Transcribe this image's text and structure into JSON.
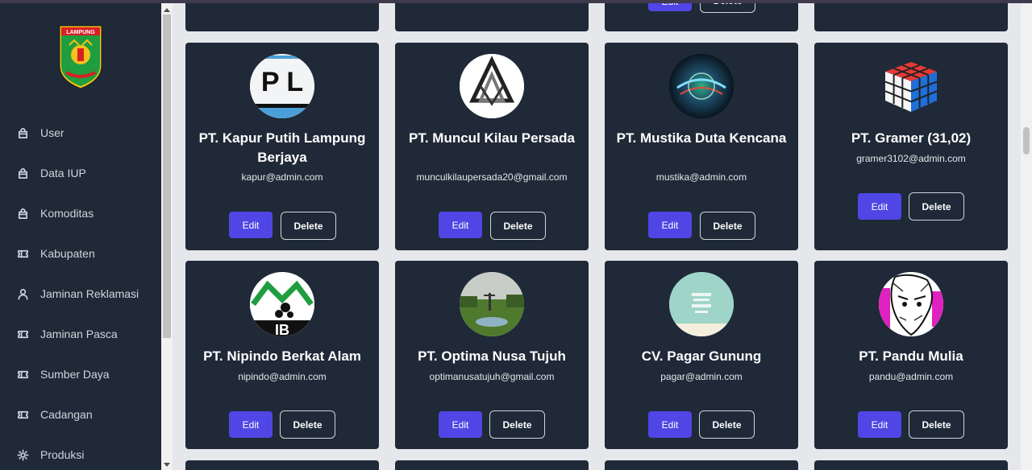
{
  "sidebar": {
    "logo_text": "LAMPUNG",
    "items": [
      {
        "label": "User",
        "icon": "bag-icon"
      },
      {
        "label": "Data IUP",
        "icon": "bag-icon"
      },
      {
        "label": "Komoditas",
        "icon": "bag-icon"
      },
      {
        "label": "Kabupaten",
        "icon": "ticket-icon"
      },
      {
        "label": "Jaminan Reklamasi",
        "icon": "user-icon"
      },
      {
        "label": "Jaminan Pasca",
        "icon": "ticket-icon"
      },
      {
        "label": "Sumber Daya",
        "icon": "ticket-icon"
      },
      {
        "label": "Cadangan",
        "icon": "ticket-icon"
      },
      {
        "label": "Produksi",
        "icon": "gear-icon"
      }
    ]
  },
  "actions": {
    "edit_label": "Edit",
    "delete_label": "Delete"
  },
  "companies": [
    {
      "name": "PT. Kapur Putih Lampung Berjaya",
      "email": "kapur@admin.com",
      "avatar_text": "P L"
    },
    {
      "name": "PT. Muncul Kilau Persada",
      "email": "munculkilaupersada20@gmail.com"
    },
    {
      "name": "PT. Mustika Duta Kencana",
      "email": "mustika@admin.com"
    },
    {
      "name": "PT. Gramer (31,02)",
      "email": "gramer3102@admin.com"
    },
    {
      "name": "PT. Nipindo Berkat Alam",
      "email": "nipindo@admin.com",
      "avatar_text": "IB"
    },
    {
      "name": "PT. Optima Nusa Tujuh",
      "email": "optimanusatujuh@gmail.com"
    },
    {
      "name": "CV. Pagar Gunung",
      "email": "pagar@admin.com"
    },
    {
      "name": "PT. Pandu Mulia",
      "email": "pandu@admin.com"
    }
  ],
  "colors": {
    "sidebar_bg": "#1f2937",
    "card_bg": "#1f2937",
    "page_bg": "#e5e7eb",
    "edit_button": "#4f46e5"
  }
}
